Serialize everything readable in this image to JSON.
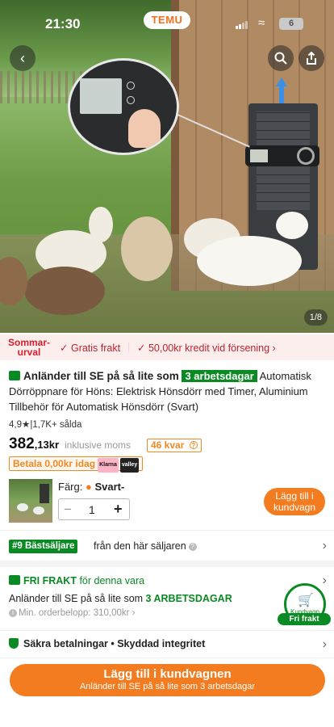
{
  "status_bar": {
    "time": "21:30",
    "brand": "TEMU",
    "battery": "6"
  },
  "gallery": {
    "counter": "1/8"
  },
  "promo": {
    "tag_line1": "Sommar-",
    "tag_line2": "urval",
    "free_shipping": "Gratis frakt",
    "credit": "50,00kr kredit vid försening",
    "accent_color": "#d61f2c"
  },
  "product": {
    "arrival_lead": "Anländer till SE på så lite som",
    "arrival_days": "3 arbetsdagar",
    "title": "Automatisk Dörröppnare för Höns: Elektrisk Hönsdörr med Timer, Aluminium Tillbehör för Automatisk Hönsdörr (Svart)",
    "rating": "4,9",
    "sold": "1,7K+ sålda",
    "price_int": "382",
    "price_frac": ",13kr",
    "price_note": "inklusive moms",
    "stock": "46 kvar",
    "pay_label": "Betala 0,00kr idag",
    "pay_brand1": "Klarna",
    "pay_brand2": "valley"
  },
  "options": {
    "color_label": "Färg:",
    "color_value": "Svart-",
    "quantity": "1",
    "add_to_cart_small": "Lägg till i kundvagn"
  },
  "seller": {
    "badge": "#9 Bästsäljare",
    "text": "från den här säljaren"
  },
  "shipping": {
    "free_label": "FRI FRAKT",
    "free_rest": "för denna vara",
    "arrival_line": "Anländer till SE på så lite som",
    "arrival_days": "3 ARBETSDAGAR",
    "min_order": "Min. orderbelopp: 310,00kr",
    "badge_label": "Kundvagn",
    "badge_strip": "Fri frakt",
    "color": "#0a8a23"
  },
  "security": {
    "text": "Säkra betalningar • Skyddad integritet"
  },
  "cta": {
    "main": "Lägg till i kundvagnen",
    "sub": "Anländer till SE på så lite som 3 arbetsdagar",
    "color": "#f47c20"
  }
}
